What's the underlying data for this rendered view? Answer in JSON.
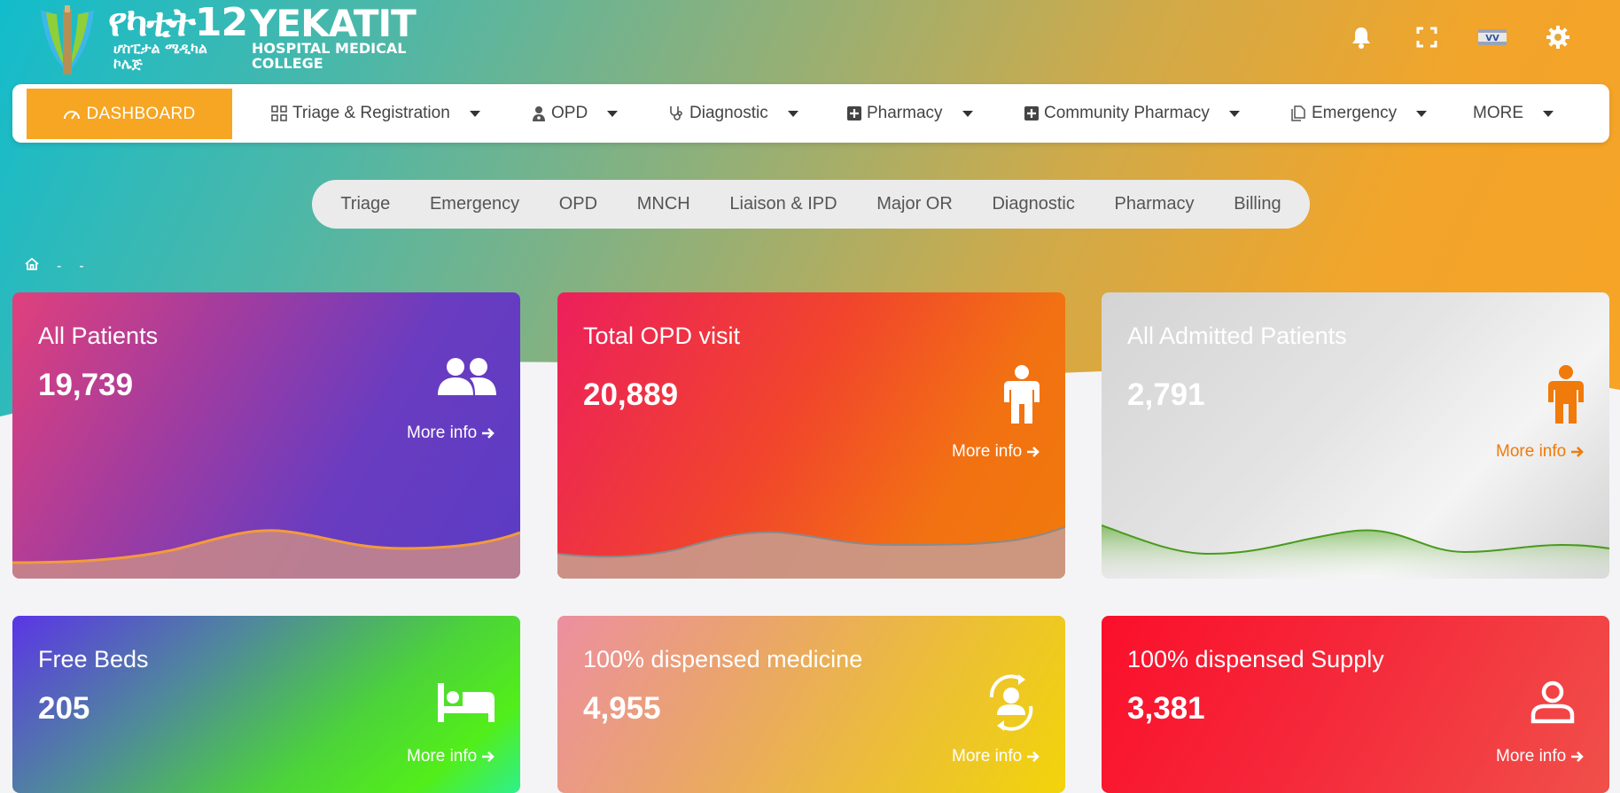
{
  "brand": {
    "amharic_name": "የካቲት12",
    "english_name": "YEKATIT",
    "amharic_subtitle": "ሆስፒታል ሜዲካል ኮሌጅ",
    "english_subtitle": "HOSPITAL MEDICAL COLLEGE"
  },
  "header_icons": [
    "bell-icon",
    "fullscreen-icon",
    "flag-icon",
    "settings-gear-icon"
  ],
  "navbar": {
    "dashboard": "DASHBOARD",
    "items": [
      {
        "label": "Triage & Registration",
        "icon": "grid-icon"
      },
      {
        "label": "OPD",
        "icon": "doctor-icon"
      },
      {
        "label": "Diagnostic",
        "icon": "stethoscope-icon"
      },
      {
        "label": "Pharmacy",
        "icon": "plus-square-icon"
      },
      {
        "label": "Community Pharmacy",
        "icon": "plus-square-icon"
      },
      {
        "label": "Emergency",
        "icon": "documents-icon"
      },
      {
        "label": "MORE",
        "icon": ""
      }
    ]
  },
  "pills": [
    "Triage",
    "Emergency",
    "OPD",
    "MNCH",
    "Liaison & IPD",
    "Major OR",
    "Diagnostic",
    "Pharmacy",
    "Billing"
  ],
  "breadcrumb": {
    "sep1": "-",
    "sep2": "-"
  },
  "cards": [
    {
      "title": "All Patients",
      "value": "19,739",
      "more": "More info",
      "icon": "users-icon"
    },
    {
      "title": "Total OPD visit",
      "value": "20,889",
      "more": "More info",
      "icon": "person-icon"
    },
    {
      "title": "All Admitted Patients",
      "value": "2,791",
      "more": "More info",
      "icon": "person-icon"
    },
    {
      "title": "Free Beds",
      "value": "205",
      "more": "More info",
      "icon": "bed-icon"
    },
    {
      "title": "100% dispensed medicine",
      "value": "4,955",
      "more": "More info",
      "icon": "person-sync-icon"
    },
    {
      "title": "100% dispensed Supply",
      "value": "3,381",
      "more": "More info",
      "icon": "user-outline-icon"
    }
  ],
  "colors": {
    "accent": "#f6a623",
    "nav_text": "#444444",
    "admitted_accent": "#f07a0a"
  }
}
